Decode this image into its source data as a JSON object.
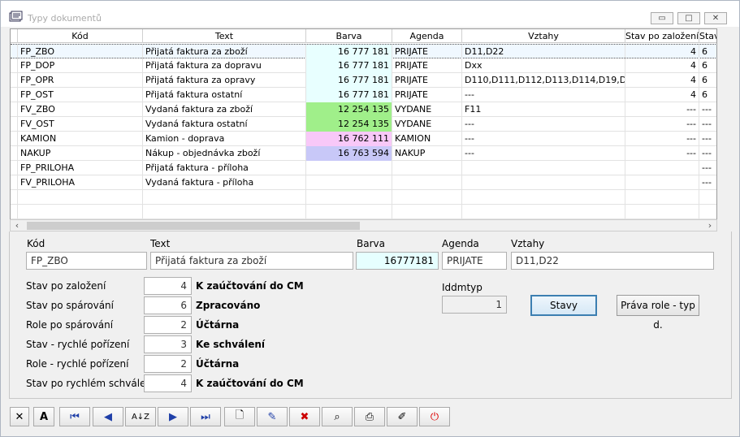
{
  "window": {
    "title": "Typy dokumentů"
  },
  "grid": {
    "columns": [
      "Kód",
      "Text",
      "Barva",
      "Agenda",
      "Vztahy",
      "Stav po založení",
      "Stav"
    ],
    "rows": [
      {
        "kod": "FP_ZBO",
        "text": "Přijatá faktura za zboží",
        "barva": "16 777 181",
        "agenda": "PRIJATE",
        "vztahy": "D11,D22",
        "stav": "4",
        "stav2": "6",
        "color": "#e8ffff"
      },
      {
        "kod": "FP_DOP",
        "text": "Přijatá faktura za dopravu",
        "barva": "16 777 181",
        "agenda": "PRIJATE",
        "vztahy": "Dxx",
        "stav": "4",
        "stav2": "6",
        "color": "#e8ffff"
      },
      {
        "kod": "FP_OPR",
        "text": "Přijatá faktura za opravy",
        "barva": "16 777 181",
        "agenda": "PRIJATE",
        "vztahy": "D110,D111,D112,D113,D114,D19,D",
        "stav": "4",
        "stav2": "6",
        "color": "#e8ffff"
      },
      {
        "kod": "FP_OST",
        "text": "Přijatá faktura ostatní",
        "barva": "16 777 181",
        "agenda": "PRIJATE",
        "vztahy": "---",
        "stav": "4",
        "stav2": "6",
        "color": "#e8ffff"
      },
      {
        "kod": "FV_ZBO",
        "text": "Vydaná faktura za zboží",
        "barva": "12 254 135",
        "agenda": "VYDANE",
        "vztahy": "F11",
        "stav": "---",
        "stav2": "---",
        "color": "#a0ef8a"
      },
      {
        "kod": "FV_OST",
        "text": "Vydaná faktura ostatní",
        "barva": "12 254 135",
        "agenda": "VYDANE",
        "vztahy": "---",
        "stav": "---",
        "stav2": "---",
        "color": "#a0ef8a"
      },
      {
        "kod": "KAMION",
        "text": "Kamion - doprava",
        "barva": "16 762 111",
        "agenda": "KAMION",
        "vztahy": "---",
        "stav": "---",
        "stav2": "---",
        "color": "#f8c8f8"
      },
      {
        "kod": "NAKUP",
        "text": "Nákup - objednávka zboží",
        "barva": "16 763 594",
        "agenda": "NAKUP",
        "vztahy": "---",
        "stav": "---",
        "stav2": "---",
        "color": "#c8c8f8"
      },
      {
        "kod": "FP_PRILOHA",
        "text": "Přijatá faktura - příloha",
        "barva": "",
        "agenda": "",
        "vztahy": "",
        "stav": "",
        "stav2": "---",
        "color": ""
      },
      {
        "kod": "FV_PRILOHA",
        "text": "Vydaná faktura - příloha",
        "barva": "",
        "agenda": "",
        "vztahy": "",
        "stav": "",
        "stav2": "---",
        "color": ""
      }
    ]
  },
  "detail": {
    "kod_label": "Kód",
    "text_label": "Text",
    "barva_label": "Barva",
    "agenda_label": "Agenda",
    "vztahy_label": "Vztahy",
    "kod": "FP_ZBO",
    "text": "Přijatá faktura za zboží",
    "barva": "16777181",
    "agenda": "PRIJATE",
    "vztahy": "D11,D22",
    "states": [
      {
        "label": "Stav po založení",
        "value": "4",
        "desc": "K zaúčtování do CM"
      },
      {
        "label": "Stav po spárování",
        "value": "6",
        "desc": "Zpracováno"
      },
      {
        "label": "Role po spárování",
        "value": "2",
        "desc": "Účtárna"
      },
      {
        "label": "Stav - rychlé pořízení",
        "value": "3",
        "desc": "Ke schválení"
      },
      {
        "label": "Role - rychlé pořízení",
        "value": "2",
        "desc": "Účtárna"
      },
      {
        "label": "Stav po rychlém schválení",
        "value": "4",
        "desc": "K zaúčtování do CM"
      }
    ],
    "iddmtyp_label": "Iddmtyp",
    "iddmtyp": "1",
    "stavy_button": "Stavy",
    "prava_button": "Práva role - typ d."
  }
}
